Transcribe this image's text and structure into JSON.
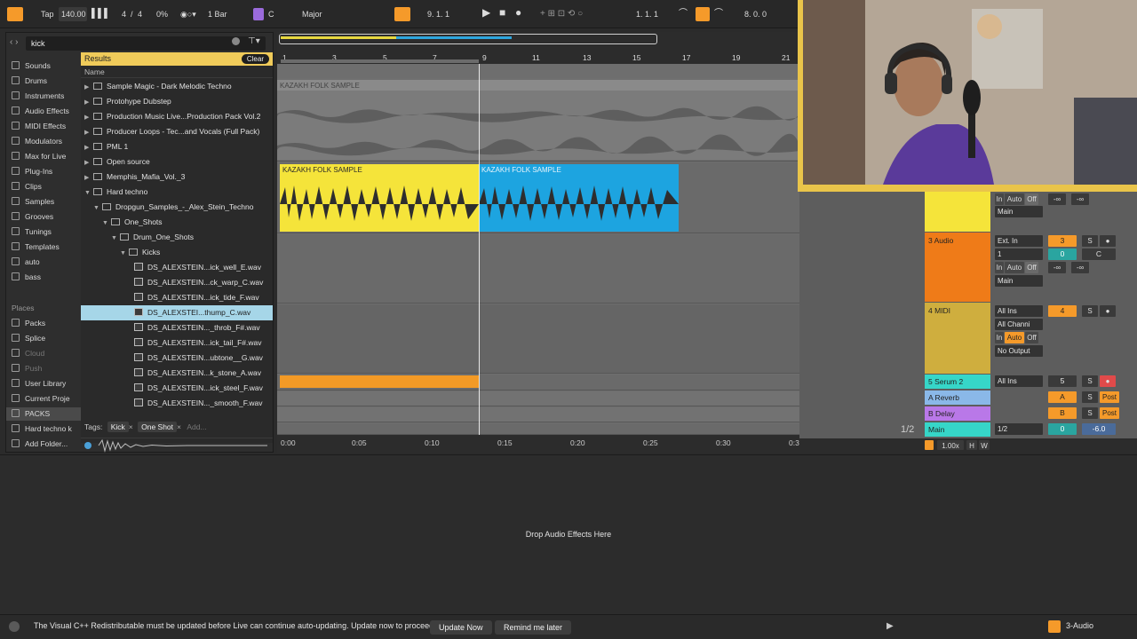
{
  "transport": {
    "tap": "Tap",
    "bpm": "140.00",
    "meter_num": "4",
    "meter_sep": "/",
    "meter_den": "4",
    "groove": "0%",
    "quant": "1 Bar",
    "key_root": "C",
    "scale": "Major",
    "position": "9.  1.  1",
    "loop_start": "1.  1.  1",
    "loop_len": "8.  0.  0"
  },
  "browser": {
    "search": "kick",
    "categories": [
      "Sounds",
      "Drums",
      "Instruments",
      "Audio Effects",
      "MIDI Effects",
      "Modulators",
      "Max for Live",
      "Plug-Ins",
      "Clips",
      "Samples",
      "Grooves",
      "Tunings",
      "Templates",
      "auto",
      "bass"
    ],
    "places_label": "Places",
    "places": [
      "Packs",
      "Splice",
      "Cloud",
      "Push",
      "User Library",
      "Current Proje",
      "PACKS",
      "Hard techno k",
      "Add Folder..."
    ],
    "results_label": "Results",
    "clear": "Clear",
    "name_header": "Name",
    "rows": [
      "Sample Magic - Dark Melodic Techno",
      "Protohype Dubstep",
      "Production Music Live...Production Pack Vol.2",
      "Producer Loops - Tec...and Vocals (Full Pack)",
      "PML 1",
      "Open source",
      "Memphis_Mafia_Vol._3",
      "Hard techno",
      "Dropgun_Samples_-_Alex_Stein_Techno",
      "One_Shots",
      "Drum_One_Shots",
      "Kicks",
      "DS_ALEXSTEIN...ick_well_E.wav",
      "DS_ALEXSTEIN...ck_warp_C.wav",
      "DS_ALEXSTEIN...ick_tide_F.wav",
      "DS_ALEXSTEI...thump_C.wav",
      "DS_ALEXSTEIN..._throb_F#.wav",
      "DS_ALEXSTEIN...ick_tail_F#.wav",
      "DS_ALEXSTEIN...ubtone__G.wav",
      "DS_ALEXSTEIN...k_stone_A.wav",
      "DS_ALEXSTEIN...ick_steel_F.wav",
      "DS_ALEXSTEIN..._smooth_F.wav"
    ],
    "tags_label": "Tags:",
    "tag1": "Kick",
    "tag2": "One Shot",
    "tag_add": "Add..."
  },
  "arrangement": {
    "bars": [
      "1",
      "3",
      "5",
      "7",
      "9",
      "11",
      "13",
      "15",
      "17",
      "19",
      "21"
    ],
    "times": [
      "0:00",
      "0:05",
      "0:10",
      "0:15",
      "0:20",
      "0:25",
      "0:30",
      "0:35",
      "0:40"
    ],
    "clip_top": "KAZAKH FOLK SAMPLE",
    "clip_yellow": "KAZAKH FOLK SAMPLE",
    "clip_blue": "KAZAKH FOLK SAMPLE"
  },
  "mixer": {
    "in": "In",
    "auto": "Auto",
    "off": "Off",
    "inf": "-∞",
    "main": "Main",
    "t3_name": "3 Audio",
    "t3_input": "Ext. In",
    "t3_ch": "1",
    "t3_num": "3",
    "t3_vol": "0",
    "t3_pan": "C",
    "t4_name": "4 MIDI",
    "t4_input": "All Ins",
    "t4_ch": "All Channi",
    "t4_num": "4",
    "t4_out": "No Output",
    "t5_name": "5 Serum 2",
    "t5_input": "All Ins",
    "t5_num": "5",
    "ra_name": "A Reverb",
    "ra_letter": "A",
    "rb_name": "B Delay",
    "rb_letter": "B",
    "post": "Post",
    "main_name": "Main",
    "main_sel": "1/2",
    "main_vol": "0",
    "main_db": "-6.0",
    "s": "S",
    "page": "1/2",
    "zoom": "1.00x",
    "h": "H",
    "w": "W"
  },
  "device": {
    "drop": "Drop Audio Effects Here"
  },
  "status": {
    "message": "The Visual C++ Redistributable must be updated before Live can continue auto-updating. Update now to proceed.",
    "update": "Update Now",
    "remind": "Remind me later",
    "track": "3-Audio"
  },
  "colors": {
    "yellow": "#f5e43a",
    "blue": "#1da4e0",
    "orange": "#f39a26",
    "reshead": "#f0cb5a",
    "cyan": "#36d6c8",
    "purple": "#b978e8"
  }
}
